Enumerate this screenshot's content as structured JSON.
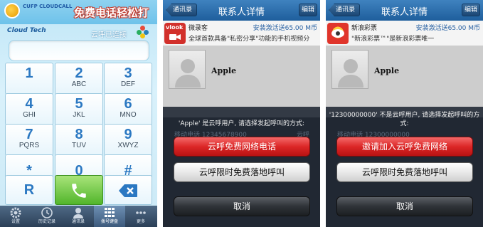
{
  "dialer": {
    "logo_text": "CUFP CLOUDCALL",
    "slogan": "免费电话轻松打",
    "brand": "Cloud Tech",
    "status": "云呼已连接",
    "keys": [
      {
        "digit": "1",
        "letters": ""
      },
      {
        "digit": "2",
        "letters": "ABC"
      },
      {
        "digit": "3",
        "letters": "DEF"
      },
      {
        "digit": "4",
        "letters": "GHI"
      },
      {
        "digit": "5",
        "letters": "JKL"
      },
      {
        "digit": "6",
        "letters": "MNO"
      },
      {
        "digit": "7",
        "letters": "PQRS"
      },
      {
        "digit": "8",
        "letters": "TUV"
      },
      {
        "digit": "9",
        "letters": "XWYZ"
      },
      {
        "digit": "*",
        "letters": ""
      },
      {
        "digit": "0",
        "letters": ""
      },
      {
        "digit": "#",
        "letters": ""
      },
      {
        "digit": "R",
        "letters": ""
      }
    ],
    "tabs": [
      {
        "label": "设置",
        "icon": "gear-icon"
      },
      {
        "label": "历史记录",
        "icon": "clock-icon"
      },
      {
        "label": "通讯录",
        "icon": "contacts-icon"
      },
      {
        "label": "拨号键盘",
        "icon": "keypad-icon",
        "active": true
      },
      {
        "label": "更多",
        "icon": "more-icon"
      }
    ],
    "colors": {
      "digit": "#2b78c2",
      "call": "#52b52b",
      "tabbar": "#2b3f57"
    }
  },
  "detail_apple": {
    "back": "通讯录",
    "title": "联系人详情",
    "edit": "编辑",
    "ad": {
      "icon_text": "vlook",
      "line1": "微录客",
      "line1_right": "安装激活送65.00 M币",
      "line2": "全球首款具备\"私密分享\"功能的手机视频分"
    },
    "name": "Apple",
    "prompt": "'Apple' 是云呼用户, 请选择发起呼叫的方式:",
    "ghost_line": "移动电话 12345678900",
    "ghost_tag": "云呼",
    "option1": "云呼免费网络电话",
    "option2": "云呼限时免费落地呼叫",
    "cancel": "取消"
  },
  "detail_number": {
    "back": "通讯录",
    "title": "联系人详情",
    "edit": "编辑",
    "ad": {
      "line1": "新浪彩票",
      "line1_right": "安装激活送65.00 M币",
      "line2": "\"新浪彩票™\"是新浪彩票唯一"
    },
    "name": "Apple",
    "prompt": "'12300000000' 不是云呼用户, 请选择发起呼叫的方式:",
    "ghost_line": "移动电话 12300000000",
    "option1": "邀请加入云呼免费网络",
    "option2": "云呼限时免费落地呼叫",
    "cancel": "取消"
  }
}
